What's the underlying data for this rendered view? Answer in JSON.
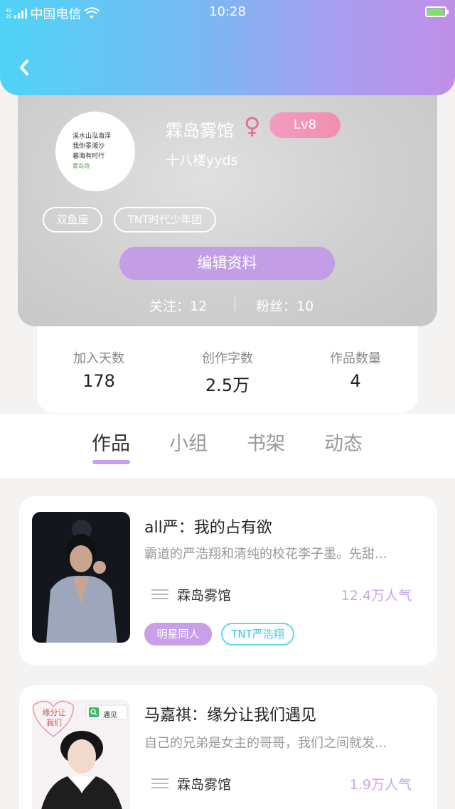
{
  "status_bar": {
    "network": "4G|2G",
    "carrier": "中国电信",
    "time": "10:28",
    "battery_color": "#7ee26a"
  },
  "header": {
    "back_icon": "chevron-left-icon",
    "gradient": [
      "#4fd3f6",
      "#c08fe8"
    ]
  },
  "profile": {
    "avatar_text": [
      "溪水山泓海泽",
      "我你景湘沙",
      "暮海有时行",
      "雾岛馆"
    ],
    "nickname": "霖岛雾馆",
    "gender_icon": "female-icon",
    "level": "Lv8",
    "signature": "十八楼yyds",
    "tags": [
      "双鱼座",
      "TNT时代少年团"
    ],
    "edit_button": "编辑资料",
    "following": "关注：12",
    "followers": "粉丝：10",
    "accent": "#c39de6"
  },
  "stats": [
    {
      "label": "加入天数",
      "value": "178"
    },
    {
      "label": "创作字数",
      "value": "2.5万"
    },
    {
      "label": "作品数量",
      "value": "4"
    }
  ],
  "tabs": [
    {
      "label": "作品",
      "active": true
    },
    {
      "label": "小组",
      "active": false
    },
    {
      "label": "书架",
      "active": false
    },
    {
      "label": "动态",
      "active": false
    }
  ],
  "works": [
    {
      "title": "all严：我的占有欲",
      "description": "霸道的严浩翔和清纯的校花李子墨。先甜...",
      "author": "霖岛雾馆",
      "popularity": "12.4万人气",
      "tags": [
        "明星同人",
        "TNT严浩翔"
      ]
    },
    {
      "title": "马嘉祺：缘分让我们遇见",
      "description": "自己的兄弟是女主的哥哥，我们之间就发...",
      "author": "霖岛雾馆",
      "popularity": "1.9万人气",
      "cover_text": [
        "缘分让",
        "我们"
      ],
      "cover_search": "遇见"
    }
  ]
}
